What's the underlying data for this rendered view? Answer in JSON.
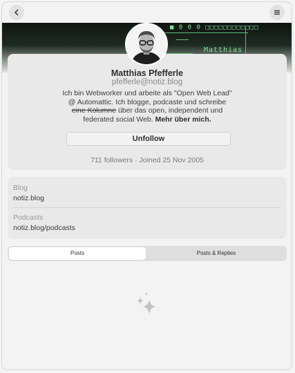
{
  "header": {
    "back_icon": "chevron-left-icon",
    "menu_icon": "hamburger-menu-icon"
  },
  "banner": {
    "top_text": "■ 0 0 0 □□□□□□□□□□□□",
    "name_text": "Matthias"
  },
  "profile": {
    "name": "Matthias Pfefferle",
    "handle": "pfefferle@notiz.blog",
    "bio_part1": "Ich bin Webworker und arbeite als \"Open Web Lead\" @ Automattic. Ich blogge, podcaste und schreibe ",
    "bio_strike": "eine Kolumne",
    "bio_part2": " über das open, independent und federated social Web. ",
    "bio_bold": "Mehr über mich.",
    "unfollow_label": "Unfollow",
    "stats": "711 followers · Joined 25 Nov 2005"
  },
  "fields": [
    {
      "label": "Blog",
      "value": "notiz.blog"
    },
    {
      "label": "Podcasts",
      "value": "notiz.blog/podcasts"
    }
  ],
  "tabs": {
    "posts": "Posts",
    "replies": "Posts & Replies"
  },
  "empty_state_icon": "sparkles-icon",
  "colors": {
    "background": "#f3f3f3",
    "card": "#e9e9e9",
    "banner_text": "#7fe29a"
  }
}
